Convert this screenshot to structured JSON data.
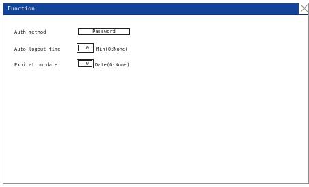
{
  "window": {
    "title": "Function"
  },
  "auth": {
    "label": "Auth method",
    "value": "Password"
  },
  "logout": {
    "label": "Auto logout time",
    "value": "0",
    "unit": "Min(0:None)"
  },
  "expiration": {
    "label": "Expiration date",
    "value": "0",
    "unit": "Date(0:None)"
  },
  "icons": {
    "close": "close-icon"
  }
}
